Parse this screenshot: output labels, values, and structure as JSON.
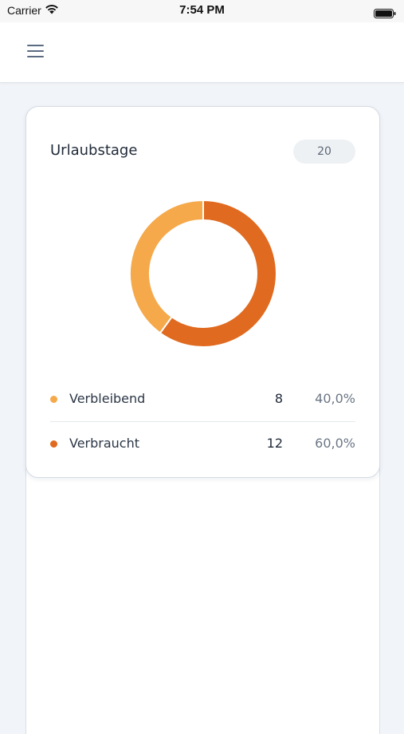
{
  "status_bar": {
    "carrier": "Carrier",
    "time": "7:54 PM",
    "wifi_icon": "wifi-icon",
    "battery_icon": "battery-icon"
  },
  "header": {
    "menu_icon": "hamburger-menu-icon"
  },
  "card": {
    "title": "Urlaubstage",
    "total_badge": "20"
  },
  "chart_data": {
    "type": "pie",
    "donut": true,
    "title": "",
    "series": [
      {
        "name": "Verbleibend",
        "value": 8,
        "percent": "40,0%",
        "color": "#f5a94a"
      },
      {
        "name": "Verbraucht",
        "value": 12,
        "percent": "60,0%",
        "color": "#e06a1f"
      }
    ]
  }
}
